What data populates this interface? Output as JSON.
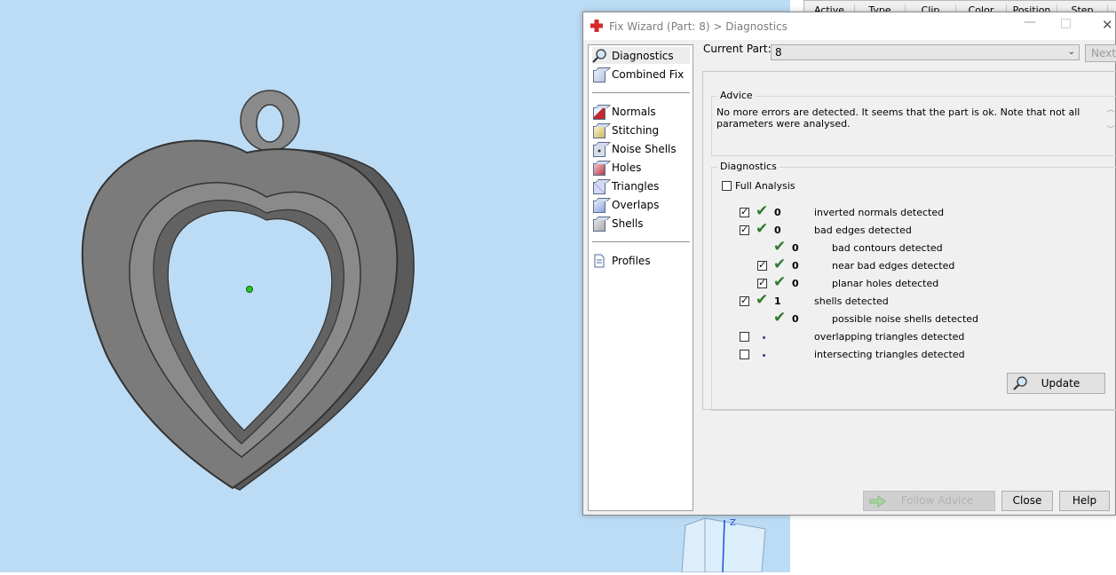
{
  "background_table": {
    "headers": [
      "Active",
      "Type",
      "Clip",
      "Color",
      "Position",
      "Step"
    ]
  },
  "axis": {
    "z_label": "Z"
  },
  "dialog": {
    "title": "Fix Wizard (Part: 8) > Diagnostics",
    "nav": {
      "top": [
        {
          "label": "Diagnostics",
          "icon": "magnifier-icon",
          "selected": true
        },
        {
          "label": "Combined Fix",
          "icon": "cube-icon"
        }
      ],
      "tools": [
        {
          "label": "Normals",
          "icon": "normals-cube-icon"
        },
        {
          "label": "Stitching",
          "icon": "stitching-cube-icon"
        },
        {
          "label": "Noise Shells",
          "icon": "noise-shells-icon"
        },
        {
          "label": "Holes",
          "icon": "holes-cube-icon"
        },
        {
          "label": "Triangles",
          "icon": "triangles-cube-icon"
        },
        {
          "label": "Overlaps",
          "icon": "overlaps-cube-icon"
        },
        {
          "label": "Shells",
          "icon": "shells-cube-icon"
        }
      ],
      "bottom": [
        {
          "label": "Profiles",
          "icon": "document-icon"
        }
      ]
    },
    "current_part_label": "Current Part:",
    "current_part_value": "8",
    "next_label": "Next",
    "advice": {
      "title": "Advice",
      "text": "No more errors are detected. It seems that the part is ok. Note that not all parameters were analysed."
    },
    "diagnostics": {
      "title": "Diagnostics",
      "full_analysis_label": "Full Analysis",
      "full_analysis_checked": false,
      "rows": [
        {
          "checkbox": true,
          "checked": true,
          "status": "ok",
          "count": "0",
          "label": "inverted normals detected",
          "indent": 0
        },
        {
          "checkbox": true,
          "checked": true,
          "status": "ok",
          "count": "0",
          "label": "bad edges detected",
          "indent": 0
        },
        {
          "checkbox": false,
          "checked": false,
          "status": "ok",
          "count": "0",
          "label": "bad contours detected",
          "indent": 1
        },
        {
          "checkbox": true,
          "checked": true,
          "status": "ok",
          "count": "0",
          "label": "near bad edges detected",
          "indent": 1
        },
        {
          "checkbox": true,
          "checked": true,
          "status": "ok",
          "count": "0",
          "label": "planar holes detected",
          "indent": 1
        },
        {
          "checkbox": true,
          "checked": true,
          "status": "ok",
          "count": "1",
          "label": "shells detected",
          "indent": 0
        },
        {
          "checkbox": false,
          "checked": false,
          "status": "ok",
          "count": "0",
          "label": "possible noise shells detected",
          "indent": 1
        },
        {
          "checkbox": true,
          "checked": false,
          "status": "pending",
          "count": "",
          "label": "overlapping triangles detected",
          "indent": 0
        },
        {
          "checkbox": true,
          "checked": false,
          "status": "pending",
          "count": "",
          "label": "intersecting triangles detected",
          "indent": 0
        }
      ],
      "update_label": "Update"
    },
    "buttons": {
      "follow_advice": "Follow Advice",
      "close": "Close",
      "help": "Help"
    }
  },
  "colors": {
    "viewport_bg": "#bcdcf5",
    "model_gray": "#7b7b7b",
    "check_green": "#2e7a2e",
    "app_icon_red": "#d42a2a"
  }
}
